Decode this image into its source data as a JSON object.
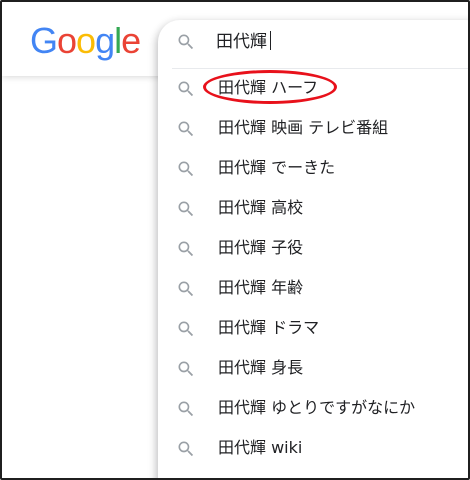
{
  "logo": {
    "letters": [
      "G",
      "o",
      "o",
      "g",
      "l",
      "e"
    ],
    "colors": [
      "#4285F4",
      "#EA4335",
      "#FBBC05",
      "#4285F4",
      "#34A853",
      "#EA4335"
    ]
  },
  "search": {
    "value": "田代輝",
    "icon": "search-icon"
  },
  "suggestions": [
    {
      "text": "田代輝 ハーフ",
      "icon": "search-icon"
    },
    {
      "text": "田代輝 映画 テレビ番組",
      "icon": "search-icon"
    },
    {
      "text": "田代輝 でーきた",
      "icon": "search-icon"
    },
    {
      "text": "田代輝 高校",
      "icon": "search-icon"
    },
    {
      "text": "田代輝 子役",
      "icon": "search-icon"
    },
    {
      "text": "田代輝 年齢",
      "icon": "search-icon"
    },
    {
      "text": "田代輝 ドラマ",
      "icon": "search-icon"
    },
    {
      "text": "田代輝 身長",
      "icon": "search-icon"
    },
    {
      "text": "田代輝 ゆとりですがなにか",
      "icon": "search-icon"
    },
    {
      "text": "田代輝 wiki",
      "icon": "search-icon"
    }
  ],
  "highlight": {
    "color": "#e8111b",
    "target_index": 0
  }
}
